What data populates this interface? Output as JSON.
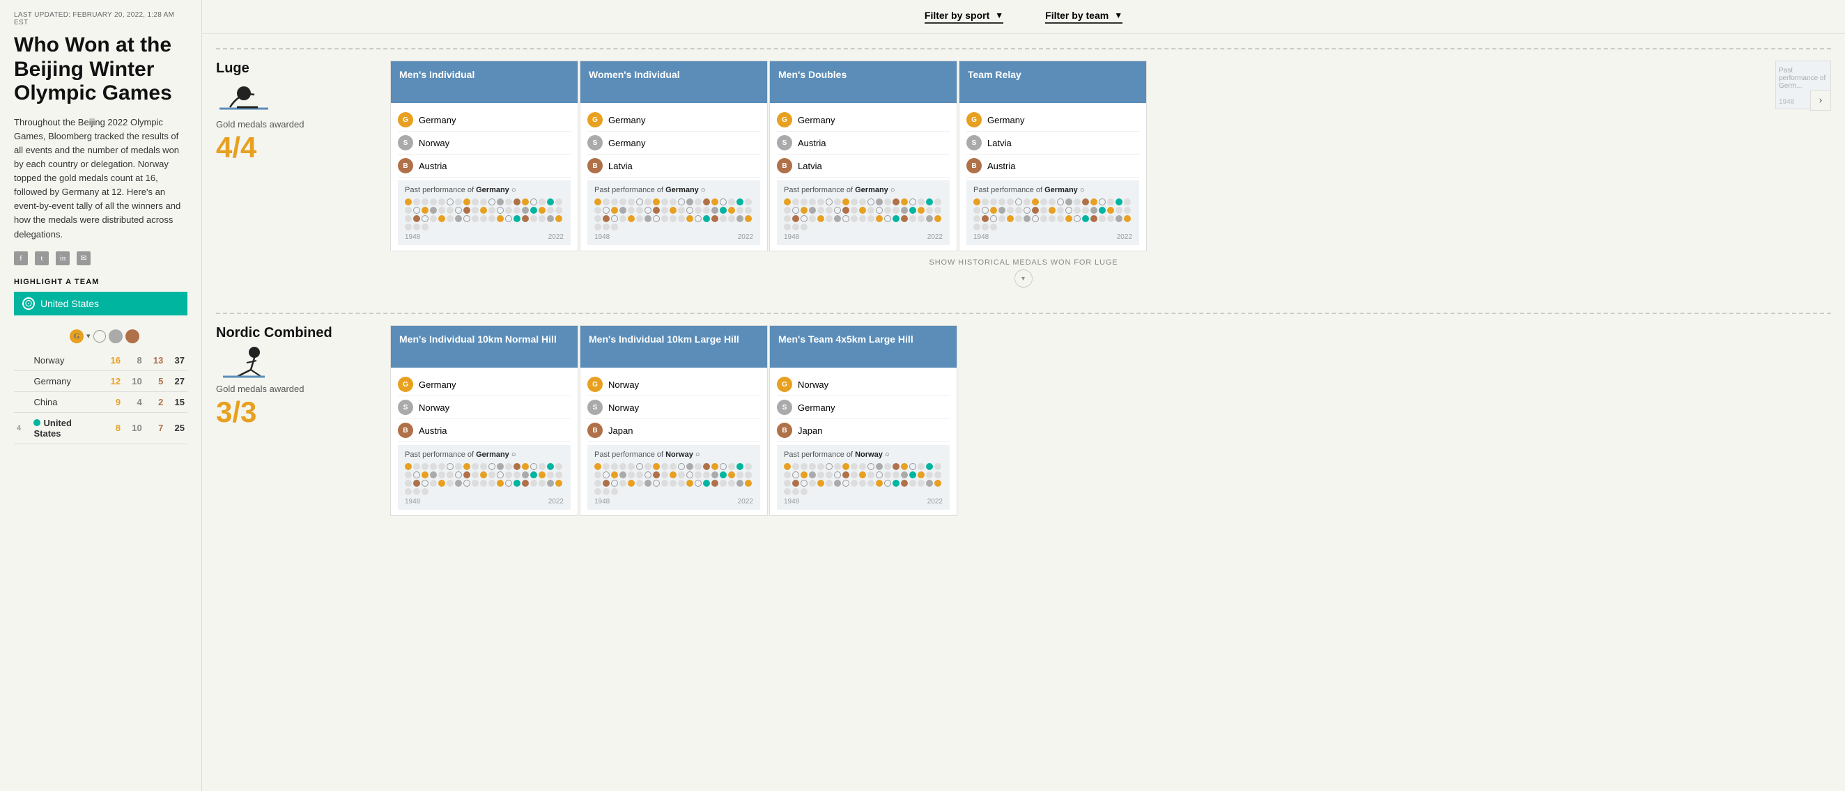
{
  "meta": {
    "last_updated": "LAST UPDATED: FEBRUARY 20, 2022, 1:28 AM EST"
  },
  "sidebar": {
    "title": "Who Won at the Beijing Winter Olympic Games",
    "description": "Throughout the Beijing 2022 Olympic Games, Bloomberg tracked the results of all events and the number of medals won by each country or delegation. Norway topped the gold medals count at 16, followed by Germany at 12. Here's an event-by-event tally of all the winners and how the medals were distributed across delegations.",
    "highlight_label": "HIGHLIGHT A TEAM",
    "highlight_team": "United States",
    "medal_cols": [
      "G▾",
      "○",
      "",
      ""
    ],
    "standings": [
      {
        "rank": "",
        "country": "Norway",
        "gold": 16,
        "silver": 8,
        "bronze": 13,
        "total": 37,
        "highlighted": false
      },
      {
        "rank": "",
        "country": "Germany",
        "gold": 12,
        "silver": 10,
        "bronze": 5,
        "total": 27,
        "highlighted": false
      },
      {
        "rank": "",
        "country": "China",
        "gold": 9,
        "silver": 4,
        "bronze": 2,
        "total": 15,
        "highlighted": false
      },
      {
        "rank": "4",
        "country": "United States",
        "gold": 8,
        "silver": 10,
        "bronze": 7,
        "total": 25,
        "highlighted": true
      }
    ]
  },
  "nav": {
    "filter_sport_label": "Filter by sport",
    "filter_team_label": "Filter by team"
  },
  "sections": [
    {
      "id": "luge",
      "sport": "Luge",
      "gold_medals_awarded_label": "Gold medals awarded",
      "gold_fraction": "4/4",
      "show_historical_label": "SHOW HISTORICAL MEDALS WON FOR LUGE",
      "events": [
        {
          "title": "Men's Individual",
          "medals": [
            {
              "type": "G",
              "country": "Germany"
            },
            {
              "type": "S",
              "country": "Norway"
            },
            {
              "type": "B",
              "country": "Austria"
            }
          ],
          "past_perf_team": "Germany",
          "year_start": "1948",
          "year_end": "2022"
        },
        {
          "title": "Women's Individual",
          "medals": [
            {
              "type": "G",
              "country": "Germany"
            },
            {
              "type": "S",
              "country": "Germany"
            },
            {
              "type": "B",
              "country": "Latvia"
            }
          ],
          "past_perf_team": "Germany",
          "year_start": "1948",
          "year_end": "2022"
        },
        {
          "title": "Men's Doubles",
          "medals": [
            {
              "type": "G",
              "country": "Germany"
            },
            {
              "type": "S",
              "country": "Austria"
            },
            {
              "type": "B",
              "country": "Latvia"
            }
          ],
          "past_perf_team": "Germany",
          "year_start": "1948",
          "year_end": "2022"
        },
        {
          "title": "Team Relay",
          "medals": [
            {
              "type": "G",
              "country": "Germany"
            },
            {
              "type": "S",
              "country": "Latvia"
            },
            {
              "type": "B",
              "country": "Austria"
            }
          ],
          "past_perf_team": "Germany",
          "year_start": "1948",
          "year_end": "2022"
        }
      ]
    },
    {
      "id": "nordic",
      "sport": "Nordic Combined",
      "gold_medals_awarded_label": "Gold medals awarded",
      "gold_fraction": "3/3",
      "show_historical_label": "",
      "events": [
        {
          "title": "Men's Individual 10km Normal Hill",
          "medals": [
            {
              "type": "G",
              "country": "Germany"
            },
            {
              "type": "S",
              "country": "Norway"
            },
            {
              "type": "B",
              "country": "Austria"
            }
          ],
          "past_perf_team": "Germany",
          "year_start": "1948",
          "year_end": "2022"
        },
        {
          "title": "Men's Individual 10km Large Hill",
          "medals": [
            {
              "type": "G",
              "country": "Norway"
            },
            {
              "type": "S",
              "country": "Norway"
            },
            {
              "type": "B",
              "country": "Japan"
            }
          ],
          "past_perf_team": "Norway",
          "year_start": "1948",
          "year_end": "2022"
        },
        {
          "title": "Men's Team 4x5km Large Hill",
          "medals": [
            {
              "type": "G",
              "country": "Norway"
            },
            {
              "type": "S",
              "country": "Germany"
            },
            {
              "type": "B",
              "country": "Japan"
            }
          ],
          "past_perf_team": "Norway",
          "year_start": "1948",
          "year_end": "2022"
        }
      ]
    }
  ],
  "colors": {
    "teal": "#00b5a0",
    "gold": "#e8a020",
    "silver": "#aaaaaa",
    "bronze": "#b07048",
    "card_header_blue": "#5b8db8",
    "past_perf_bg": "#eef2f5"
  }
}
